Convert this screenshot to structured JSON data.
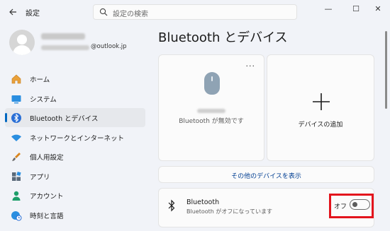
{
  "window": {
    "app_title": "設定",
    "back_icon": "back-arrow-icon",
    "controls": {
      "minimize": "—",
      "maximize": "☐",
      "close": "✕"
    }
  },
  "search": {
    "placeholder": "設定の検索"
  },
  "account": {
    "email_suffix": "@outlook.jp"
  },
  "sidebar": {
    "items": [
      {
        "label": "ホーム",
        "icon": "home-icon"
      },
      {
        "label": "システム",
        "icon": "display-icon"
      },
      {
        "label": "Bluetooth とデバイス",
        "icon": "bluetooth-icon",
        "selected": true
      },
      {
        "label": "ネットワークとインターネット",
        "icon": "wifi-icon"
      },
      {
        "label": "個人用設定",
        "icon": "paintbrush-icon"
      },
      {
        "label": "アプリ",
        "icon": "apps-icon"
      },
      {
        "label": "アカウント",
        "icon": "person-icon"
      },
      {
        "label": "時刻と言語",
        "icon": "globe-clock-icon"
      }
    ]
  },
  "main": {
    "title": "Bluetooth とデバイス",
    "device_card": {
      "more": "...",
      "status": "Bluetooth が無効です",
      "icon": "mouse-icon"
    },
    "add_card": {
      "label": "デバイスの追加",
      "icon": "plus-icon"
    },
    "more_devices_label": "その他のデバイスを表示",
    "bluetooth_row": {
      "title": "Bluetooth",
      "subtitle": "Bluetooth がオフになっています",
      "toggle_label": "オフ",
      "toggle_on": false
    }
  },
  "colors": {
    "accent": "#0067c0",
    "highlight": "#e3141d",
    "background": "#f1f3f8"
  }
}
